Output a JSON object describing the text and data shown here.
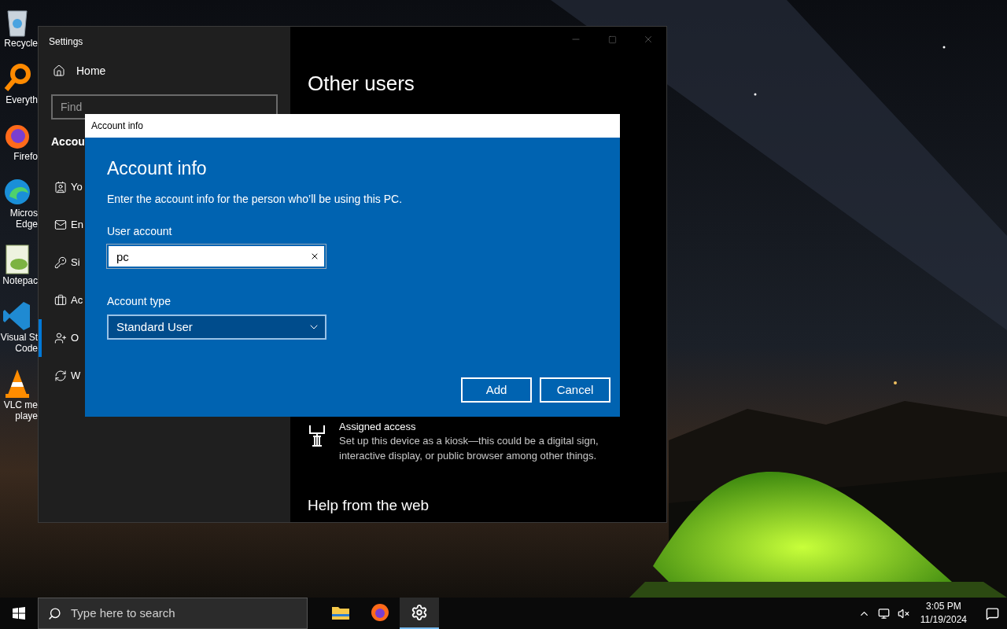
{
  "desktop_icons": [
    {
      "kind": "recycle",
      "label": "Recycle"
    },
    {
      "kind": "ring",
      "label": "Everyth"
    },
    {
      "kind": "firefox",
      "label": "Firefo"
    },
    {
      "kind": "edge",
      "label": "Micros\nEdge"
    },
    {
      "kind": "notepad",
      "label": "Notepac"
    },
    {
      "kind": "vscode",
      "label": "Visual St\nCode"
    },
    {
      "kind": "vlc",
      "label": "VLC me\nplaye"
    }
  ],
  "settings_window": {
    "title": "Settings",
    "sidebar": {
      "home": "Home",
      "search_placeholder": "Find",
      "section": "Accou",
      "items": [
        {
          "kind": "info",
          "label": "Yo",
          "selected": false
        },
        {
          "kind": "mail",
          "label": "En",
          "selected": false
        },
        {
          "kind": "key",
          "label": "Si",
          "selected": false
        },
        {
          "kind": "briefcase",
          "label": "Ac",
          "selected": false
        },
        {
          "kind": "adduser",
          "label": "O",
          "selected": true
        },
        {
          "kind": "sync",
          "label": "W",
          "selected": false
        }
      ]
    },
    "content": {
      "heading": "Other users",
      "assigned_access": {
        "title": "Assigned access",
        "description": "Set up this device as a kiosk—this could be a digital sign, interactive display, or public browser among other things."
      },
      "help_heading": "Help from the web"
    }
  },
  "dialog": {
    "title": "Account info",
    "heading": "Account info",
    "description": "Enter the account info for the person who’ll be using this PC.",
    "user_account": {
      "label": "User account",
      "value": "pc"
    },
    "account_type": {
      "label": "Account type",
      "value": "Standard User"
    },
    "buttons": [
      "Add",
      "Cancel"
    ]
  },
  "taskbar": {
    "search_placeholder": "Type here to search",
    "apps": [
      {
        "kind": "folder",
        "selected": false
      },
      {
        "kind": "firefox",
        "selected": false
      },
      {
        "kind": "settings",
        "selected": true
      }
    ],
    "time": "3:05 PM",
    "date": "11/19/2024"
  }
}
